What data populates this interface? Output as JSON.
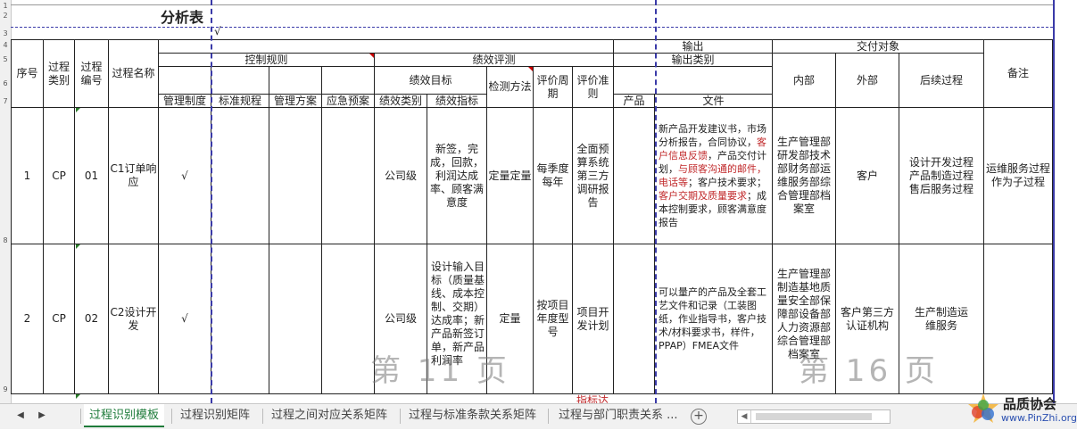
{
  "sheet": {
    "title": "分析表",
    "title_check": "√",
    "row_numbers": [
      "1",
      "2",
      "3",
      "4",
      "5",
      "6",
      "7",
      "8",
      "9"
    ],
    "headers": {
      "seq": "序号",
      "proc_cat": "过程类别",
      "proc_no": "过程编号",
      "proc_name": "过程名称",
      "control_rules": "控制规则",
      "perf_eval": "绩效评测",
      "perf_target": "绩效目标",
      "check_method": "检测方法",
      "eval_cycle": "评价周期",
      "eval_criteria": "评价准则",
      "output": "输出",
      "output_cat": "输出类别",
      "delivery": "交付对象",
      "internal": "内部",
      "external": "外部",
      "subsequent": "后续过程",
      "remark": "备注",
      "mgmt_system": "管理制度",
      "std_procedure": "标准规程",
      "mgmt_plan": "管理方案",
      "emergency_plan": "应急预案",
      "perf_type": "绩效类别",
      "perf_index": "绩效指标",
      "product": "产品",
      "document": "文件"
    },
    "rows": [
      {
        "seq": "1",
        "cat": "CP",
        "no": "01",
        "name": "C1订单响应",
        "mgmt": "√",
        "perf_type": "公司级",
        "perf_index": "新签，完成，回款，利润达成率、顾客满意度",
        "method": "定量定量",
        "cycle": "每季度每年",
        "criteria": "全面预算系统第三方调研报告",
        "doc_1": "新产品开发建议书，市场分析报告，合同协议，",
        "doc_2": "客户信息反馈",
        "doc_3": "，产品交付计划，",
        "doc_4": "与顾客沟通的邮件，电话等",
        "doc_5": "；客户技术要求；",
        "doc_6": "客户交期及质量要求",
        "doc_7": "；成本控制要求，顾客满意度报告",
        "internal": "生产管理部研发部技术部财务部运维服务部综合管理部档案室",
        "external": "客户",
        "subsequent": "设计开发过程产品制造过程售后服务过程",
        "remark": "运维服务过程作为子过程"
      },
      {
        "seq": "2",
        "cat": "CP",
        "no": "02",
        "name": "C2设计开发",
        "mgmt": "√",
        "perf_type": "公司级",
        "perf_index": "设计输入目标（质量基线、成本控制、交期）达成率；新产品新签订单，新产品利润率",
        "method": "定量",
        "cycle": "按项目年度型号",
        "criteria": "项目开发计划",
        "doc": "可以量产的产品及全套工艺文件和记录（工装图纸，作业指导书，客户技术/材料要求书，样件，PPAP）FMEA文件",
        "internal": "生产管理部制造基地质量安全部保障部设备部人力资源部综合管理部档案室",
        "external": "客户第三方认证机构",
        "subsequent": "生产制造运维服务",
        "remark": ""
      }
    ],
    "page_marks": [
      "第 11 页",
      "第 16 页"
    ],
    "partial_red_text": "指标达"
  },
  "tabs": {
    "items": [
      "过程识别模板",
      "过程识别矩阵",
      "过程之间对应关系矩阵",
      "过程与标准条款关系矩阵",
      "过程与部门职责关系 ..."
    ],
    "active_index": 0,
    "add_symbol": "+"
  },
  "watermark": {
    "name": "品质协会",
    "url": "www.PinZhi.org"
  },
  "colors": {
    "accent_dash": "#3a3aa8",
    "active_tab": "#1e7b3a",
    "red_text": "#c0282a"
  }
}
